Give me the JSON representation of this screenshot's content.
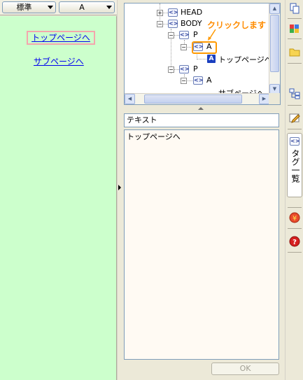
{
  "toolbar": {
    "size_select": "標準",
    "font_select": "A"
  },
  "preview": {
    "links": [
      "トップページへ",
      "サブページへ"
    ]
  },
  "tree": {
    "nodes": {
      "head": "HEAD",
      "body": "BODY",
      "p1": "P",
      "a1": "A",
      "text1": "トップページへ",
      "p2": "P",
      "a2": "A",
      "text2": "サブページへ"
    },
    "icons": {
      "tag": "<>",
      "text": "A",
      "expand": "+",
      "collapse": "−"
    },
    "callout": "クリックします"
  },
  "properties": {
    "label": "テキスト",
    "value": "トップページへ",
    "ok_label": "OK"
  },
  "side_tab": {
    "label": "タグ一覧",
    "icon": "<>"
  },
  "colors": {
    "preview_bg": "#ccffcc",
    "highlight": "#ff9900",
    "link": "#0000ee",
    "selected_link_border": "#f4a6ad"
  }
}
